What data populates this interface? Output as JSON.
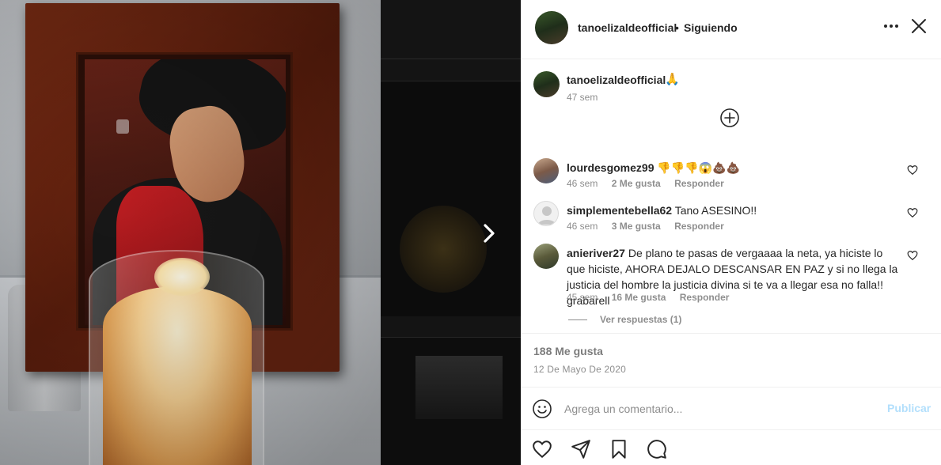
{
  "header": {
    "username": "tanoelizaldeofficial",
    "separator": "•",
    "follow_status": "Siguiendo",
    "more_icon": "more-horizontal-icon",
    "close_icon": "close-icon"
  },
  "caption": {
    "username": "tanoelizaldeofficial",
    "emoji": "🙏",
    "time": "47 sem"
  },
  "comments": [
    {
      "username": "lourdesgomez99",
      "text": "👎👎👎😱💩💩",
      "time": "46 sem",
      "likes": "2 Me gusta",
      "reply": "Responder"
    },
    {
      "username": "simplementebella62",
      "text": "Tano ASESINO!!",
      "time": "46 sem",
      "likes": "3 Me gusta",
      "reply": "Responder"
    },
    {
      "username": "anieriver27",
      "text": "De plano te pasas de vergaaaa la neta, ya hiciste lo que hiciste, AHORA DEJALO DESCANSAR EN PAZ y si no llega la justicia del hombre la justicia divina si te va a llegar esa no falla!! grabarell",
      "time": "45 sem",
      "likes": "16 Me gusta",
      "reply": "Responder"
    }
  ],
  "view_replies": "Ver respuestas (1)",
  "post": {
    "likes": "188 Me gusta",
    "date": "12 De Mayo De 2020"
  },
  "comment_box": {
    "placeholder": "Agrega un comentario...",
    "publish_label": "Publicar"
  },
  "colors": {
    "text": "#262626",
    "secondary": "#8e8e8e",
    "publish_disabled": "#b2dffc",
    "divider": "#efefef"
  }
}
